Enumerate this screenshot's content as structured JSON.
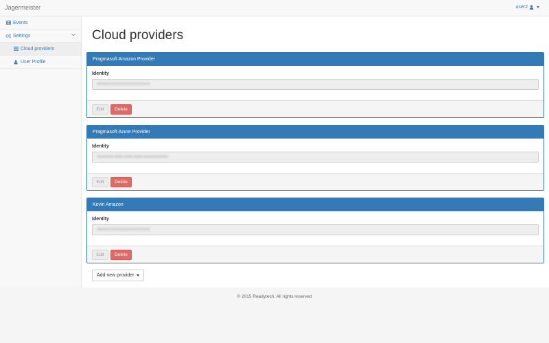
{
  "navbar": {
    "brand": "Jagermeister",
    "user": "user2"
  },
  "sidebar": {
    "items": [
      {
        "label": "Events",
        "icon": "table-icon"
      },
      {
        "label": "Settings",
        "icon": "cogs-icon"
      },
      {
        "label": "Cloud providers",
        "icon": "list-icon"
      },
      {
        "label": "User Profile",
        "icon": "user-icon"
      }
    ]
  },
  "main": {
    "title": "Cloud providers",
    "panels": [
      {
        "name": "Pragmasoft Amazon Provider",
        "identity_label": "Identity",
        "identity_value": "AKIAXXXXXXXXXXXXXXXX",
        "edit": "Edit",
        "delete": "Delete"
      },
      {
        "name": "Pragmasoft Azure Provider",
        "identity_label": "Identity",
        "identity_value": "xxxxxxxx-xxxx-xxxx-xxxx-xxxxxxxxxxxx",
        "edit": "Edit",
        "delete": "Delete"
      },
      {
        "name": "Kevin Amazon",
        "identity_label": "Identity",
        "identity_value": "AKIAXXXXXXXXXXXXXXXX",
        "edit": "Edit",
        "delete": "Delete"
      }
    ],
    "add_button": "Add new provider"
  },
  "footer": {
    "text": "© 2015 Readytech. All rights reserved"
  },
  "colors": {
    "primary": "#337ab7",
    "danger": "#d9534f"
  }
}
